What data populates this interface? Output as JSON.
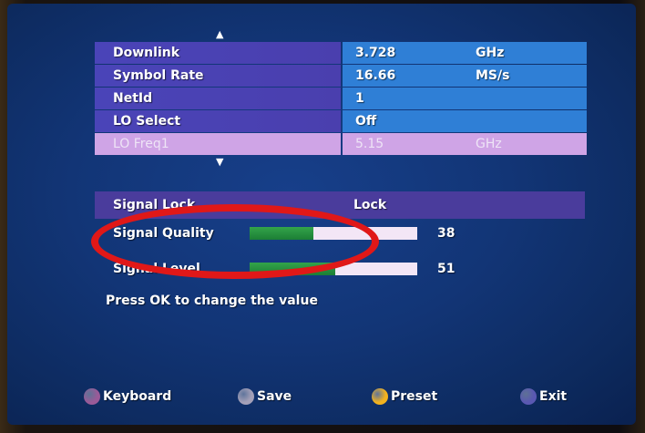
{
  "menu": {
    "rows": [
      {
        "label": "Downlink",
        "value": "3.728",
        "unit": "GHz"
      },
      {
        "label": "Symbol Rate",
        "value": "16.66",
        "unit": "MS/s"
      },
      {
        "label": "NetId",
        "value": "1",
        "unit": ""
      },
      {
        "label": "LO Select",
        "value": "Off",
        "unit": ""
      },
      {
        "label": "LO Freq1",
        "value": "5.15",
        "unit": "GHz"
      }
    ],
    "selected_index": 4
  },
  "signal": {
    "lock_label": "Signal Lock",
    "lock_value": "Lock",
    "quality_label": "Signal Quality",
    "quality_value": "38",
    "level_label": "Signal Level",
    "level_value": "51"
  },
  "hint": "Press OK to change the value",
  "footer": {
    "keyboard": "Keyboard",
    "save": "Save",
    "preset": "Preset",
    "exit": "Exit"
  },
  "colors": {
    "keyboard_dot": "#9a5a98",
    "save_dot": "#a4a0b8",
    "preset_dot": "#f2b21e",
    "exit_dot": "#5a58b2",
    "annotation": "#e01818"
  }
}
